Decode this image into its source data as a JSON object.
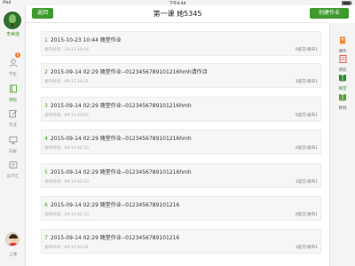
{
  "statusbar": {
    "device": "iPad",
    "time": "下午4:44",
    "battery": ""
  },
  "sidebar_left": {
    "user_name": "李美莲",
    "items": [
      {
        "label": "学生",
        "icon": "person-icon",
        "badge": "6"
      },
      {
        "label": "课程",
        "icon": "book-icon",
        "active": true
      },
      {
        "label": "作业",
        "icon": "edit-icon"
      },
      {
        "label": "白板",
        "icon": "monitor-icon"
      },
      {
        "label": "乐学汇",
        "icon": "community-icon"
      }
    ],
    "logout": "上课"
  },
  "header": {
    "back_label": "返回",
    "title": "第一课 她5345",
    "create_label": "创建作业"
  },
  "sidebar_right": {
    "items": [
      {
        "label": "课件",
        "icon": "courseware-icon"
      },
      {
        "label": "测验",
        "icon": "quiz-icon"
      },
      {
        "label": "随堂",
        "icon": "class-icon",
        "active": true
      },
      {
        "label": "教材",
        "icon": "textbook-icon"
      }
    ]
  },
  "assignments": [
    {
      "num": "1",
      "title": "2015-10-23 10:44 随堂作业",
      "meta": "发布时间：10-23 10:44",
      "stat": "0提交/发布1"
    },
    {
      "num": "2",
      "title": "2015-09-14 02:29 随堂作业--0123456789101216hmh请作诗",
      "meta": "发布时间：09-17 20:21",
      "stat": "1提交/发布1"
    },
    {
      "num": "3",
      "title": "2015-09-14 02:29 随堂作业--0123456789101216hmh",
      "meta": "发布时间：09-14 03:05",
      "stat": "0提交/发布1"
    },
    {
      "num": "4",
      "title": "2015-09-14 02:29 随堂作业--0123456789101216hmh",
      "meta": "发布时间：09-14 02:35",
      "stat": "0提交/发布1"
    },
    {
      "num": "5",
      "title": "2015-09-14 02:29 随堂作业--0123456789101216hmh",
      "meta": "发布时间：09-14 02:33",
      "stat": "1提交/发布1"
    },
    {
      "num": "6",
      "title": "2015-09-14 02:29 随堂作业--0123456789101216",
      "meta": "发布时间：09-14 02:33",
      "stat": "0提交/发布1"
    },
    {
      "num": "7",
      "title": "2015-09-14 02:29 随堂作业--0123456789101216",
      "meta": "发布时间：09-14 02:31",
      "stat": "1提交/发布1"
    }
  ],
  "colors": {
    "accent": "#3f9a2e",
    "badge": "#f07a2c"
  }
}
